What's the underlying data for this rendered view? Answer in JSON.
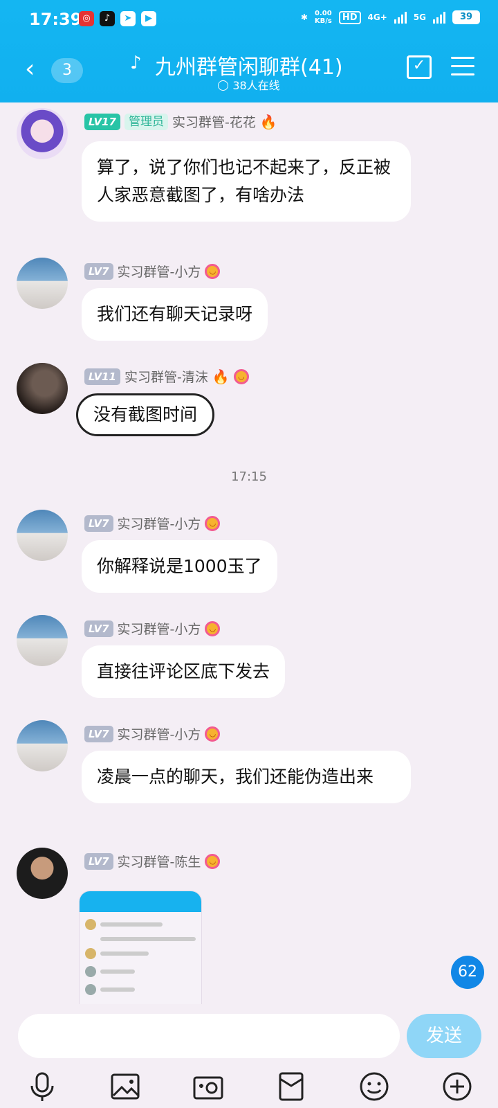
{
  "status": {
    "time": "17:39",
    "net_speed": "0.00",
    "net_unit": "KB/s",
    "hd": "HD",
    "sim1": "4G+",
    "sim2": "5G",
    "battery": "39"
  },
  "header": {
    "unread_count": "3",
    "title": "九州群管闲聊群(41)",
    "online": "38人在线"
  },
  "messages": [
    {
      "level": "LV17",
      "role": "管理员",
      "name": "实习群管-花花",
      "text": "算了，说了你们也记不起来了，反正被人家恶意截图了，有啥办法"
    },
    {
      "level": "LV7",
      "name": "实习群管-小方",
      "text": "我们还有聊天记录呀"
    },
    {
      "level": "LV11",
      "name": "实习群管-清沫",
      "text": "没有截图时间"
    },
    {
      "level": "LV7",
      "name": "实习群管-小方",
      "text": "你解释说是1000玉了"
    },
    {
      "level": "LV7",
      "name": "实习群管-小方",
      "text": "直接往评论区底下发去"
    },
    {
      "level": "LV7",
      "name": "实习群管-小方",
      "text": "凌晨一点的聊天，我们还能伪造出来"
    },
    {
      "level": "LV7",
      "name": "实习群管-陈生"
    }
  ],
  "time_separator": "17:15",
  "new_message_badge": "62",
  "input": {
    "placeholder": "",
    "send_label": "发送"
  },
  "toolbar_icons": [
    "mic-icon",
    "image-icon",
    "camera-icon",
    "red-packet-icon",
    "emoji-icon",
    "plus-icon"
  ]
}
